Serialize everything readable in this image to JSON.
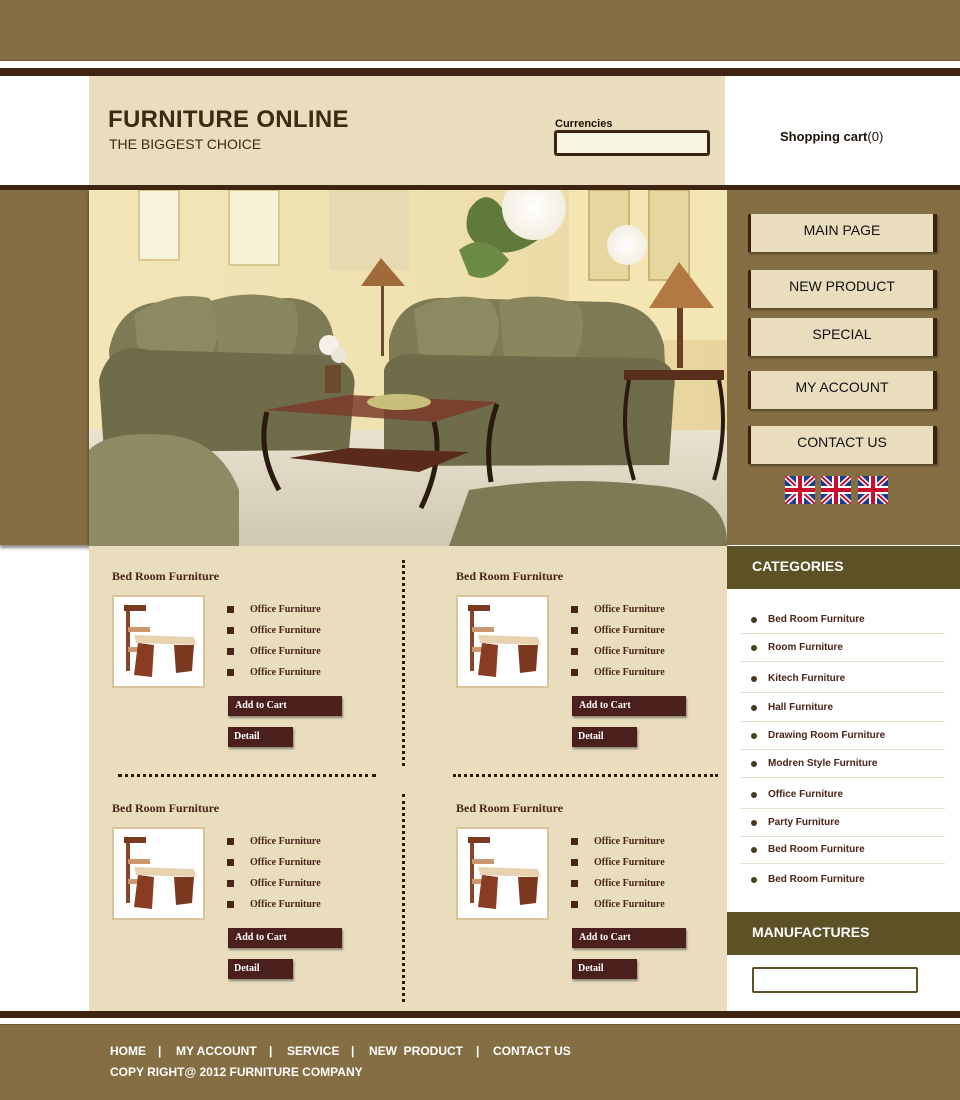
{
  "header": {
    "title": "FURNITURE ONLINE",
    "tagline": "THE BIGGEST CHOICE",
    "currencies_label": "Currencies",
    "cart_label": "Shopping cart",
    "cart_count": "(0)"
  },
  "nav": {
    "main_page": "MAIN PAGE",
    "new_product": "NEW PRODUCT",
    "special": "SPECIAL",
    "my_account": "MY ACCOUNT",
    "contact_us": "CONTACT US"
  },
  "products": [
    {
      "title": "Bed Room  Furniture",
      "features": [
        "Office Furniture",
        "Office Furniture",
        "Office Furniture",
        "Office Furniture"
      ],
      "cart_label": "Add to Cart",
      "detail_label": "Detail"
    },
    {
      "title": "Bed Room  Furniture",
      "features": [
        "Office Furniture",
        "Office Furniture",
        "Office Furniture",
        "Office Furniture"
      ],
      "cart_label": "Add to Cart",
      "detail_label": "Detail"
    },
    {
      "title": "Bed Room  Furniture",
      "features": [
        "Office Furniture",
        "Office Furniture",
        "Office Furniture",
        "Office Furniture"
      ],
      "cart_label": "Add to Cart",
      "detail_label": "Detail"
    },
    {
      "title": "Bed Room  Furniture",
      "features": [
        "Office Furniture",
        "Office Furniture",
        "Office Furniture",
        "Office Furniture"
      ],
      "cart_label": "Add to Cart",
      "detail_label": "Detail"
    }
  ],
  "sidebar": {
    "categories_title": "CATEGORIES",
    "categories": [
      "Bed Room Furniture",
      "Room Furniture",
      "Kitech Furniture",
      "Hall Furniture",
      "Drawing Room Furniture",
      "Modren Style Furniture",
      "Office Furniture",
      "Party Furniture",
      "Bed Room Furniture",
      "Bed Room Furniture"
    ],
    "manufactures_title": "MANUFACTURES"
  },
  "footer": {
    "links": [
      "HOME",
      "MY ACCOUNT",
      "SERVICE",
      "NEW  PRODUCT",
      "CONTACT US"
    ],
    "separator": "|",
    "copyright": "COPY RIGHT@ 2012 FURNITURE COMPANY"
  },
  "colors": {
    "brown_band": "#866e44",
    "dark_line": "#3f2411",
    "cream": "#e9ddbe",
    "olive": "#5c5225",
    "button_maroon": "#4b1f1b"
  }
}
